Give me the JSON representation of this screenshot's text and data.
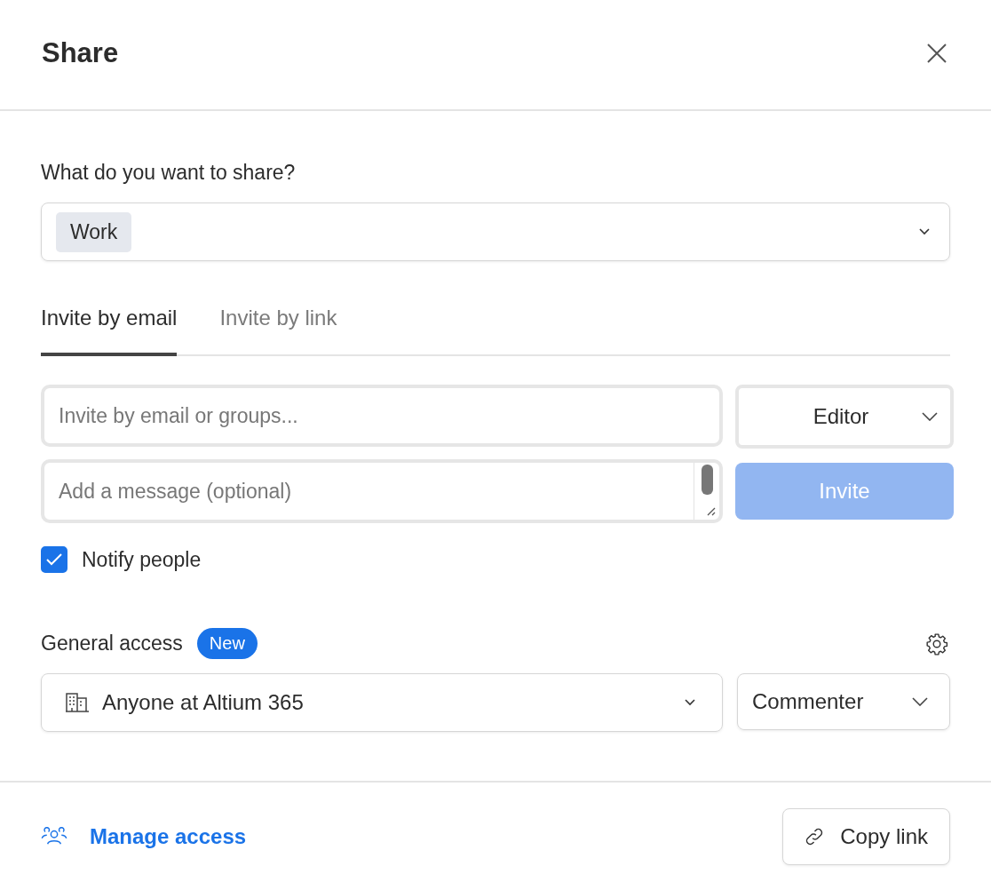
{
  "dialog": {
    "title": "Share"
  },
  "share_target": {
    "label": "What do you want to share?",
    "chips": [
      "Work"
    ]
  },
  "tabs": [
    {
      "label": "Invite by email",
      "selected": true
    },
    {
      "label": "Invite by link",
      "selected": false
    }
  ],
  "invite": {
    "email_placeholder": "Invite by email or groups...",
    "role": "Editor",
    "message_placeholder": "Add a message (optional)",
    "button": {
      "label": "Invite",
      "disabled": true
    }
  },
  "notify": {
    "label": "Notify people",
    "checked": true
  },
  "general_access": {
    "label": "General access",
    "badge": "New",
    "scope": "Anyone at Altium 365",
    "role": "Commenter"
  },
  "footer": {
    "manage_access": "Manage access",
    "copy_link": "Copy link"
  }
}
